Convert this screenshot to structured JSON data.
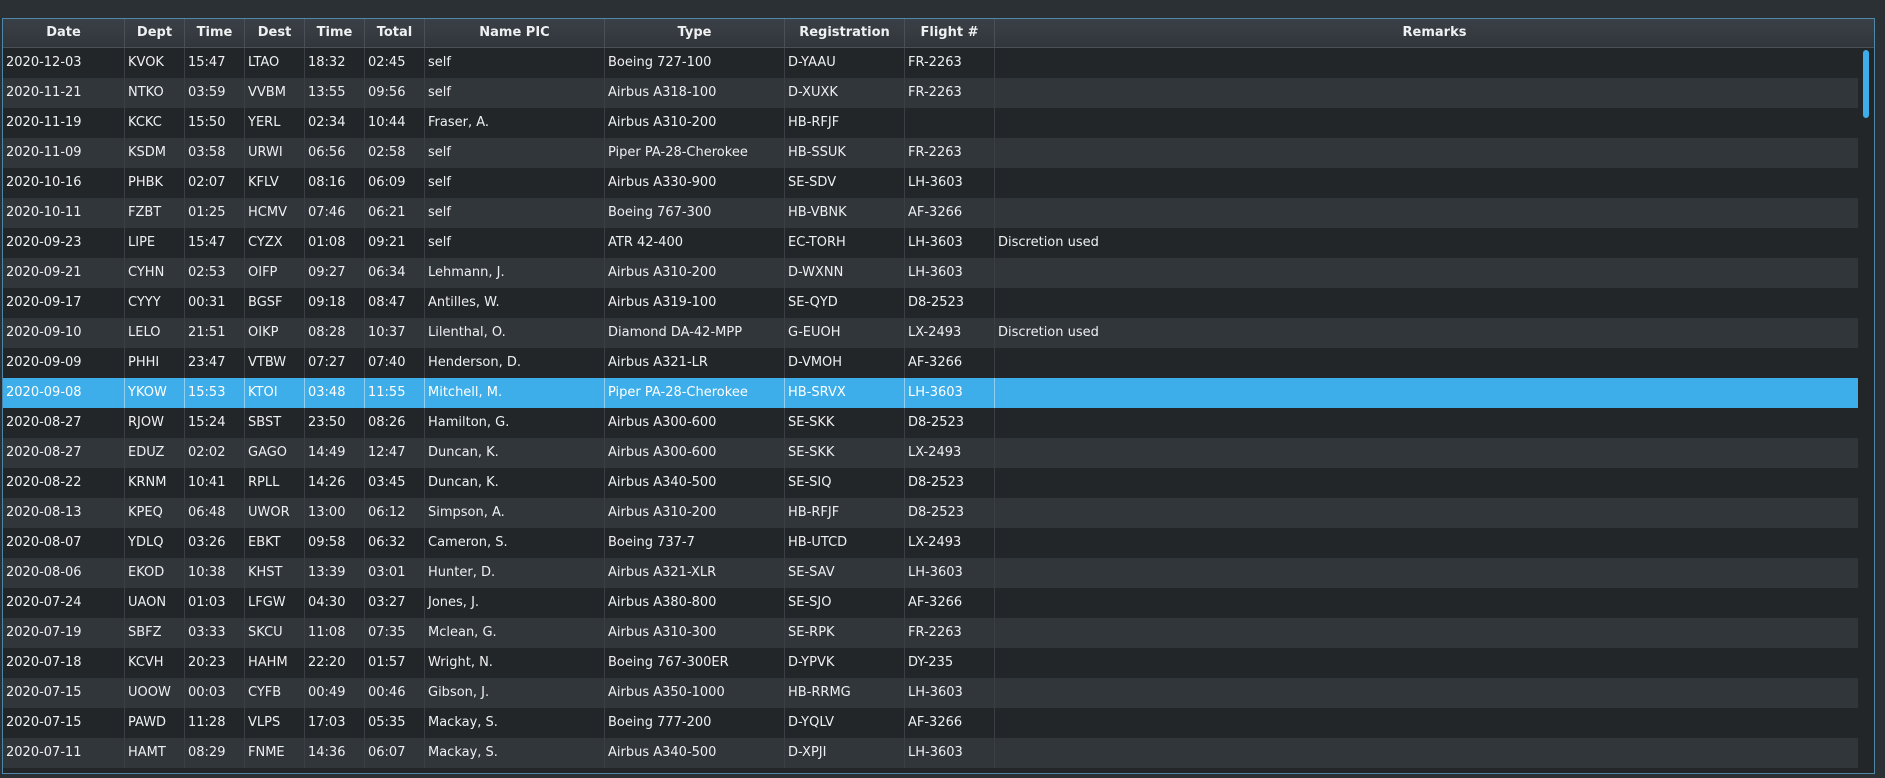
{
  "columns": [
    "Date",
    "Dept",
    "Time",
    "Dest",
    "Time",
    "Total",
    "Name PIC",
    "Type",
    "Registration",
    "Flight #",
    "Remarks"
  ],
  "selected_row": 11,
  "rows": [
    [
      "2020-12-03",
      "KVOK",
      "15:47",
      "LTAO",
      "18:32",
      "02:45",
      "self",
      "Boeing 727-100",
      "D-YAAU",
      "FR-2263",
      ""
    ],
    [
      "2020-11-21",
      "NTKO",
      "03:59",
      "VVBM",
      "13:55",
      "09:56",
      "self",
      "Airbus A318-100",
      "D-XUXK",
      "FR-2263",
      ""
    ],
    [
      "2020-11-19",
      "KCKC",
      "15:50",
      "YERL",
      "02:34",
      "10:44",
      "Fraser, A.",
      "Airbus A310-200",
      "HB-RFJF",
      "",
      ""
    ],
    [
      "2020-11-09",
      "KSDM",
      "03:58",
      "URWI",
      "06:56",
      "02:58",
      "self",
      "Piper PA-28-Cherokee",
      "HB-SSUK",
      "FR-2263",
      ""
    ],
    [
      "2020-10-16",
      "PHBK",
      "02:07",
      "KFLV",
      "08:16",
      "06:09",
      "self",
      "Airbus A330-900",
      "SE-SDV",
      "LH-3603",
      ""
    ],
    [
      "2020-10-11",
      "FZBT",
      "01:25",
      "HCMV",
      "07:46",
      "06:21",
      "self",
      "Boeing 767-300",
      "HB-VBNK",
      "AF-3266",
      ""
    ],
    [
      "2020-09-23",
      "LIPE",
      "15:47",
      "CYZX",
      "01:08",
      "09:21",
      "self",
      "ATR 42-400",
      "EC-TORH",
      "LH-3603",
      "Discretion used"
    ],
    [
      "2020-09-21",
      "CYHN",
      "02:53",
      "OIFP",
      "09:27",
      "06:34",
      "Lehmann, J.",
      "Airbus A310-200",
      "D-WXNN",
      "LH-3603",
      ""
    ],
    [
      "2020-09-17",
      "CYYY",
      "00:31",
      "BGSF",
      "09:18",
      "08:47",
      "Antilles, W.",
      "Airbus A319-100",
      "SE-QYD",
      "D8-2523",
      ""
    ],
    [
      "2020-09-10",
      "LELO",
      "21:51",
      "OIKP",
      "08:28",
      "10:37",
      "Lilenthal, O.",
      "Diamond DA-42-MPP",
      "G-EUOH",
      "LX-2493",
      "Discretion used"
    ],
    [
      "2020-09-09",
      "PHHI",
      "23:47",
      "VTBW",
      "07:27",
      "07:40",
      "Henderson, D.",
      "Airbus A321-LR",
      "D-VMOH",
      "AF-3266",
      ""
    ],
    [
      "2020-09-08",
      "YKOW",
      "15:53",
      "KTOI",
      "03:48",
      "11:55",
      "Mitchell, M.",
      "Piper PA-28-Cherokee",
      "HB-SRVX",
      "LH-3603",
      ""
    ],
    [
      "2020-08-27",
      "RJOW",
      "15:24",
      "SBST",
      "23:50",
      "08:26",
      "Hamilton, G.",
      "Airbus A300-600",
      "SE-SKK",
      "D8-2523",
      ""
    ],
    [
      "2020-08-27",
      "EDUZ",
      "02:02",
      "GAGO",
      "14:49",
      "12:47",
      "Duncan, K.",
      "Airbus A300-600",
      "SE-SKK",
      "LX-2493",
      ""
    ],
    [
      "2020-08-22",
      "KRNM",
      "10:41",
      "RPLL",
      "14:26",
      "03:45",
      "Duncan, K.",
      "Airbus A340-500",
      "SE-SIQ",
      "D8-2523",
      ""
    ],
    [
      "2020-08-13",
      "KPEQ",
      "06:48",
      "UWOR",
      "13:00",
      "06:12",
      "Simpson, A.",
      "Airbus A310-200",
      "HB-RFJF",
      "D8-2523",
      ""
    ],
    [
      "2020-08-07",
      "YDLQ",
      "03:26",
      "EBKT",
      "09:58",
      "06:32",
      "Cameron, S.",
      "Boeing 737-7",
      "HB-UTCD",
      "LX-2493",
      ""
    ],
    [
      "2020-08-06",
      "EKOD",
      "10:38",
      "KHST",
      "13:39",
      "03:01",
      "Hunter, D.",
      "Airbus A321-XLR",
      "SE-SAV",
      "LH-3603",
      ""
    ],
    [
      "2020-07-24",
      "UAON",
      "01:03",
      "LFGW",
      "04:30",
      "03:27",
      "Jones, J.",
      "Airbus A380-800",
      "SE-SJO",
      "AF-3266",
      ""
    ],
    [
      "2020-07-19",
      "SBFZ",
      "03:33",
      "SKCU",
      "11:08",
      "07:35",
      "Mclean, G.",
      "Airbus A310-300",
      "SE-RPK",
      "FR-2263",
      ""
    ],
    [
      "2020-07-18",
      "KCVH",
      "20:23",
      "HAHM",
      "22:20",
      "01:57",
      "Wright, N.",
      "Boeing 767-300ER",
      "D-YPVK",
      "DY-235",
      ""
    ],
    [
      "2020-07-15",
      "UOOW",
      "00:03",
      "CYFB",
      "00:49",
      "00:46",
      "Gibson, J.",
      "Airbus A350-1000",
      "HB-RRMG",
      "LH-3603",
      ""
    ],
    [
      "2020-07-15",
      "PAWD",
      "11:28",
      "VLPS",
      "17:03",
      "05:35",
      "Mackay, S.",
      "Boeing 777-200",
      "D-YQLV",
      "AF-3266",
      ""
    ],
    [
      "2020-07-11",
      "HAMT",
      "08:29",
      "FNME",
      "14:36",
      "06:07",
      "Mackay, S.",
      "Airbus A340-500",
      "D-XPJI",
      "LH-3603",
      ""
    ]
  ],
  "colors": {
    "selection": "#3daee9",
    "row_alt": "#31363b",
    "row_base": "#232629"
  }
}
